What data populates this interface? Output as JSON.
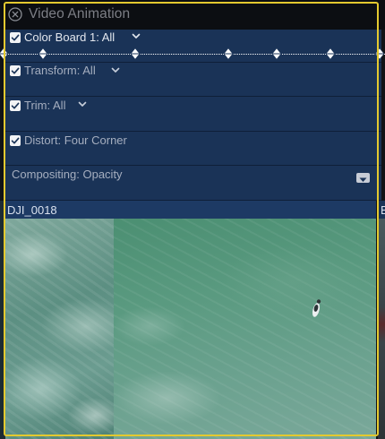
{
  "header": {
    "title": "Video Animation",
    "close_icon": "close-circle-icon"
  },
  "effects": [
    {
      "label": "Color Board 1: All",
      "enabled": true,
      "has_menu": true
    },
    {
      "label": "Transform: All",
      "enabled": true,
      "has_menu": true
    },
    {
      "label": "Trim: All",
      "enabled": true,
      "has_menu": true
    },
    {
      "label": "Distort: Four Corner",
      "enabled": true,
      "has_menu": false
    }
  ],
  "compositing": {
    "label": "Compositing: Opacity",
    "menu_icon": "dropdown-arrow-icon"
  },
  "keyframes": {
    "count": 7,
    "icon": "keyframe-diamond-icon"
  },
  "clip": {
    "name": "DJI_0018",
    "next_clip_label": "B"
  },
  "colors": {
    "row_background": "#1a3357",
    "selection_border": "#e4c92f",
    "header_background": "#0c0e12",
    "enabled_text": "#e3e7ee",
    "disabled_text": "#a5aebf"
  }
}
